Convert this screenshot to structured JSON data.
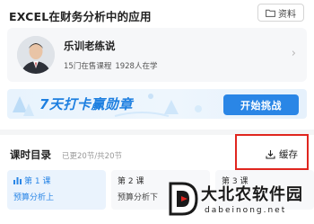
{
  "course": {
    "title": "EXCEL在财务分析中的应用"
  },
  "materials": {
    "label": "资料",
    "icon": "folder-icon"
  },
  "teacher": {
    "name": "乐训老练说",
    "courses_on_sale": "15门在售课程",
    "learners": "1928人在学",
    "chevron": "›"
  },
  "banner": {
    "text": "7天打卡赢勋章",
    "button": "开始挑战"
  },
  "catalog": {
    "title": "课时目录",
    "progress": "已更20节/共20节",
    "cache_label": "缓存",
    "cache_icon": "download-icon",
    "lessons": [
      {
        "num": "第 1 课",
        "name": "预算分析上"
      },
      {
        "num": "第 2 课",
        "name": "预算分析下"
      },
      {
        "num": "第 3 课",
        "name": ""
      }
    ]
  },
  "watermark": {
    "text": "大北农软件园",
    "domain": "dabeinong.net",
    "logo_letter": "D"
  },
  "colors": {
    "accent": "#2a86e6",
    "highlight": "#e0261f",
    "banner_text": "#1d7fe0"
  }
}
